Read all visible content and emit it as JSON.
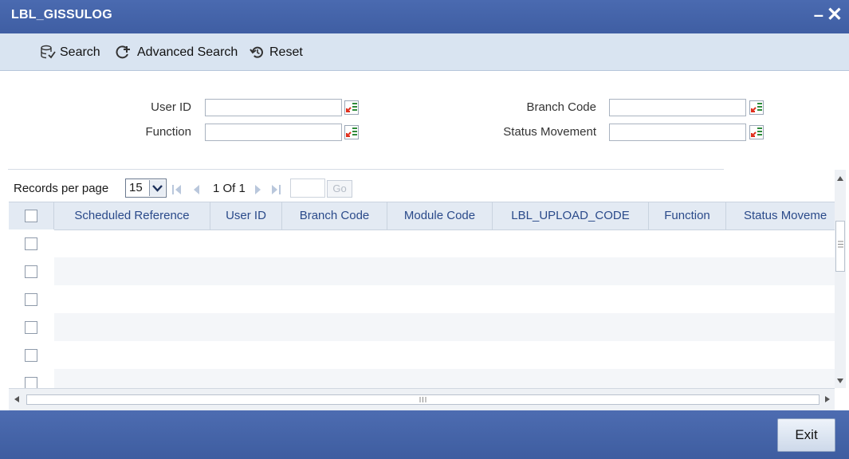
{
  "window": {
    "title": "LBL_GISSULOG",
    "minimize_glyph": "–",
    "close_glyph": "✕"
  },
  "toolbar": {
    "search_label": "Search",
    "advanced_search_label": "Advanced Search",
    "reset_label": "Reset"
  },
  "form": {
    "user_id_label": "User ID",
    "user_id_value": "",
    "function_label": "Function",
    "function_value": "",
    "branch_code_label": "Branch Code",
    "branch_code_value": "",
    "status_movement_label": "Status Movement",
    "status_movement_value": ""
  },
  "pager": {
    "records_per_page_label": "Records per page",
    "records_per_page_value": "15",
    "page_count": "1 Of 1",
    "page_input": "",
    "go_label": "Go"
  },
  "grid": {
    "columns": [
      "Scheduled Reference",
      "User ID",
      "Branch Code",
      "Module Code",
      "LBL_UPLOAD_CODE",
      "Function",
      "Status Moveme"
    ],
    "rows": [
      [],
      [],
      [],
      [],
      [],
      []
    ]
  },
  "footer": {
    "exit_label": "Exit"
  },
  "colors": {
    "title_bar": "#3f5ea3",
    "toolbar_bg": "#d9e4f1",
    "header_text": "#2a4a8a",
    "lov_red": "#e0301e",
    "lov_green": "#2e8b3a"
  }
}
